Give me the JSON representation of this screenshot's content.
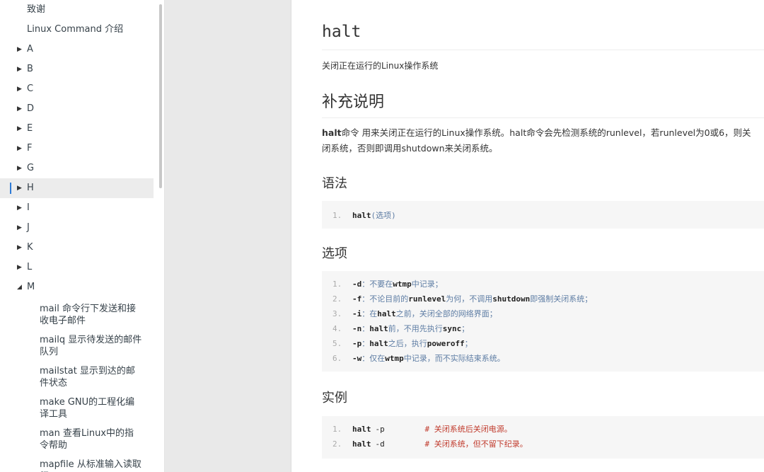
{
  "sidebar": {
    "top_items": [
      "致谢",
      "Linux Command 介绍"
    ],
    "letters": [
      "A",
      "B",
      "C",
      "D",
      "E",
      "F",
      "G",
      "H",
      "I",
      "J",
      "K",
      "L"
    ],
    "active_letter": "H",
    "expanded_letter": "M",
    "sub_items": [
      "mail 命令行下发送和接收电子邮件",
      "mailq 显示待发送的邮件队列",
      "mailstat 显示到达的邮件状态",
      "make GNU的工程化编译工具",
      "man 查看Linux中的指令帮助",
      "mapfile 从标准输入读取行"
    ]
  },
  "content": {
    "title": "halt",
    "description": "关闭正在运行的Linux操作系统",
    "section_supplement": "补充说明",
    "supplement_bold": "halt",
    "supplement_text": "命令 用来关闭正在运行的Linux操作系统。halt命令会先检测系统的runlevel，若runlevel为0或6，则关闭系统，否则即调用shutdown来关闭系统。",
    "section_syntax": "语法",
    "syntax_lines": [
      {
        "num": "1.",
        "cmd": "halt",
        "rest": "(选项)"
      }
    ],
    "section_options": "选项",
    "option_lines": [
      {
        "num": "1.",
        "flag": "-d",
        "text": "：不要在",
        "bold": "wtmp",
        "tail": "中记录；"
      },
      {
        "num": "2.",
        "flag": "-f",
        "text": "：不论目前的",
        "bold": "runlevel",
        "tail": "为何，不调用",
        "bold2": "shutdown",
        "tail2": "即强制关闭系统；"
      },
      {
        "num": "3.",
        "flag": "-i",
        "text": "：在",
        "bold": "halt",
        "tail": "之前，关闭全部的网络界面；"
      },
      {
        "num": "4.",
        "flag": "-n",
        "text": "：",
        "bold": "halt",
        "tail": "前，不用先执行",
        "bold2": "sync",
        "tail2": "；"
      },
      {
        "num": "5.",
        "flag": "-p",
        "text": "：",
        "bold": "halt",
        "tail": "之后，执行",
        "bold2": "poweroff",
        "tail2": "；"
      },
      {
        "num": "6.",
        "flag": "-w",
        "text": "：仅在",
        "bold": "wtmp",
        "tail": "中记录，而不实际结束系统。"
      }
    ],
    "section_examples": "实例",
    "example_lines": [
      {
        "num": "1.",
        "cmd": "halt",
        "arg": "-p",
        "comment": "# 关闭系统后关闭电源。"
      },
      {
        "num": "2.",
        "cmd": "halt",
        "arg": "-d",
        "comment": "# 关闭系统，但不留下纪录。"
      }
    ]
  }
}
